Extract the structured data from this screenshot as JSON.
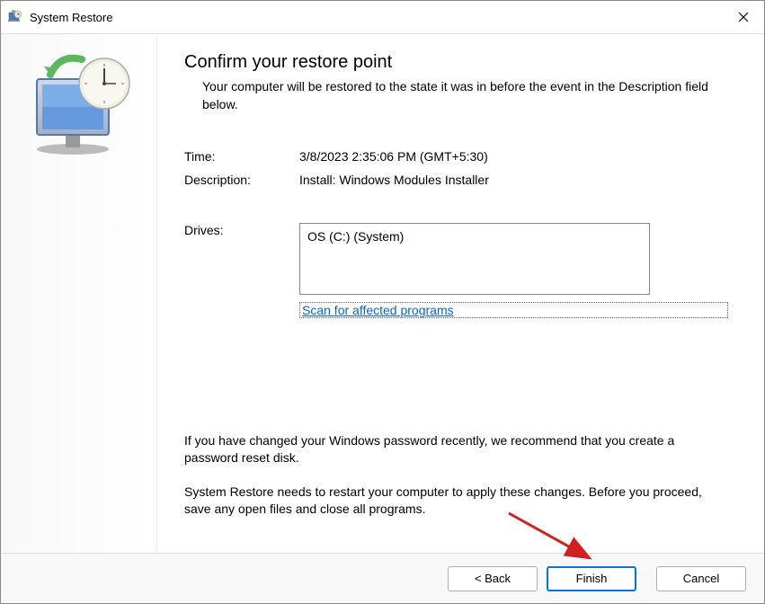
{
  "window": {
    "title": "System Restore"
  },
  "heading": "Confirm your restore point",
  "subheading": "Your computer will be restored to the state it was in before the event in the Description field below.",
  "fields": {
    "time_label": "Time:",
    "time_value": "3/8/2023 2:35:06 PM (GMT+5:30)",
    "description_label": "Description:",
    "description_value": "Install: Windows Modules Installer",
    "drives_label": "Drives:",
    "drives_value": "OS (C:) (System)"
  },
  "scan_link": "Scan for affected programs",
  "warning_password": "If you have changed your Windows password recently, we recommend that you create a password reset disk.",
  "warning_restart": "System Restore needs to restart your computer to apply these changes. Before you proceed, save any open files and close all programs.",
  "buttons": {
    "back": "< Back",
    "finish": "Finish",
    "cancel": "Cancel"
  }
}
